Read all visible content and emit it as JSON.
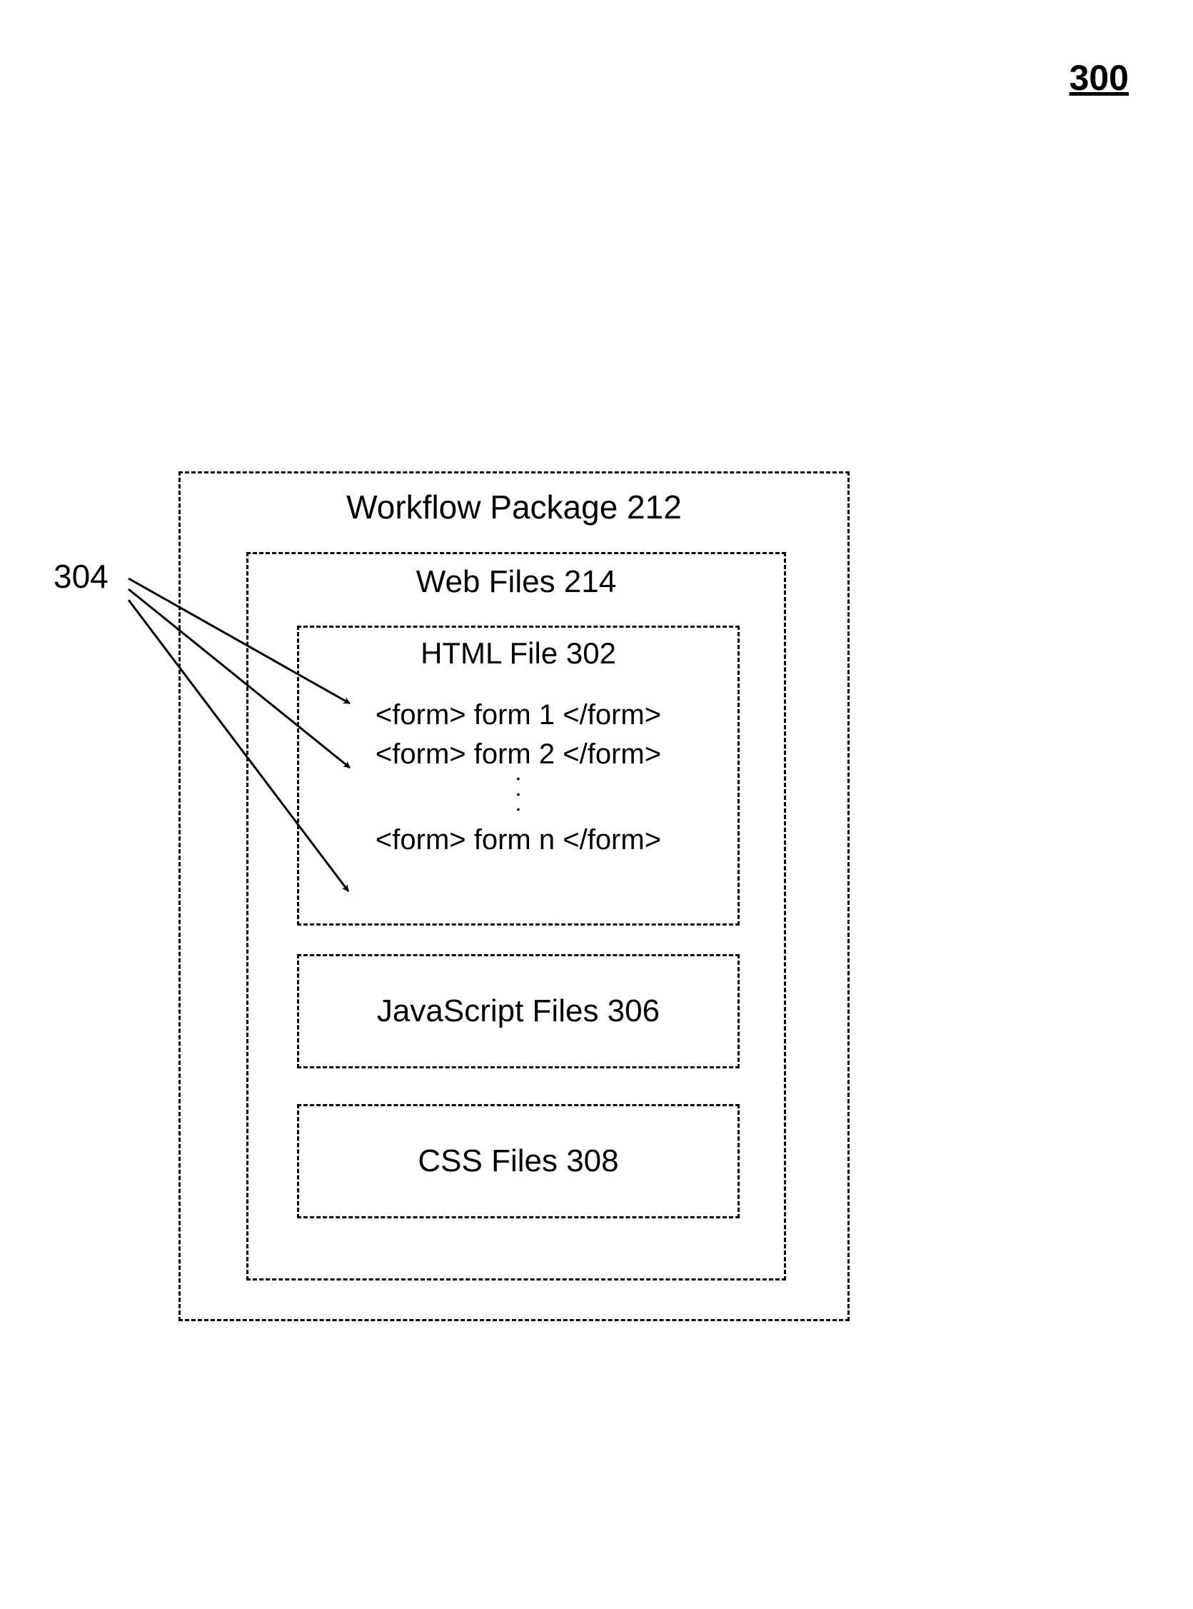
{
  "figure_number": "300",
  "ref_304": "304",
  "outer": {
    "title": "Workflow Package 212"
  },
  "web_files": {
    "title": "Web Files 214"
  },
  "html_file": {
    "title": "HTML File 302",
    "form1": "<form> form 1 </form>",
    "form2": "<form> form 2 </form>",
    "form_n": "<form> form n </form>"
  },
  "js_box": {
    "label": "JavaScript Files 306"
  },
  "css_box": {
    "label": "CSS Files 308"
  }
}
